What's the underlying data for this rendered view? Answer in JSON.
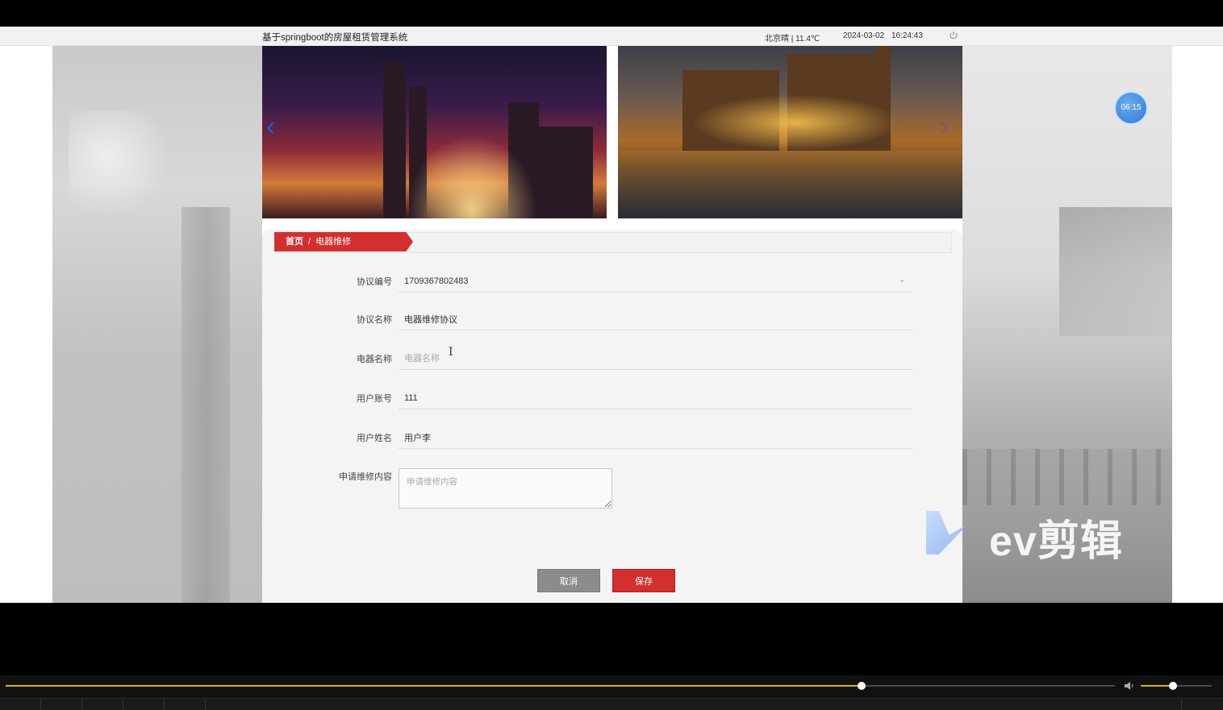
{
  "topbar": {
    "title": "基于springboot的房屋租赁管理系统",
    "weather": "北京晴 | 11.4℃",
    "date": "2024-03-02",
    "time": "16:24:43"
  },
  "clock_badge": "06:15",
  "carousel": {
    "prev_arrow": "‹",
    "next_arrow": "›"
  },
  "breadcrumb": {
    "home": "首页",
    "separator": "/",
    "current": "电器维修"
  },
  "form": {
    "agreement_no": {
      "label": "协议编号",
      "value": "1709367802483"
    },
    "agreement_name": {
      "label": "协议名称",
      "value": "电器维修协议"
    },
    "appliance_name": {
      "label": "电器名称",
      "value": "",
      "placeholder": "电器名称"
    },
    "user_account": {
      "label": "用户账号",
      "value": "111"
    },
    "user_name": {
      "label": "用户姓名",
      "value": "用户李"
    },
    "repair_content": {
      "label": "申请维修内容",
      "value": "",
      "placeholder": "申请维修内容"
    }
  },
  "buttons": {
    "cancel": "取消",
    "save": "保存"
  },
  "watermark": "ev剪辑",
  "player": {
    "progress": 0.772,
    "volume": 0.45
  },
  "colors": {
    "accent_red": "#d32f2f",
    "cancel_gray": "#8c8c8c",
    "progress_yellow": "#d9b600"
  }
}
